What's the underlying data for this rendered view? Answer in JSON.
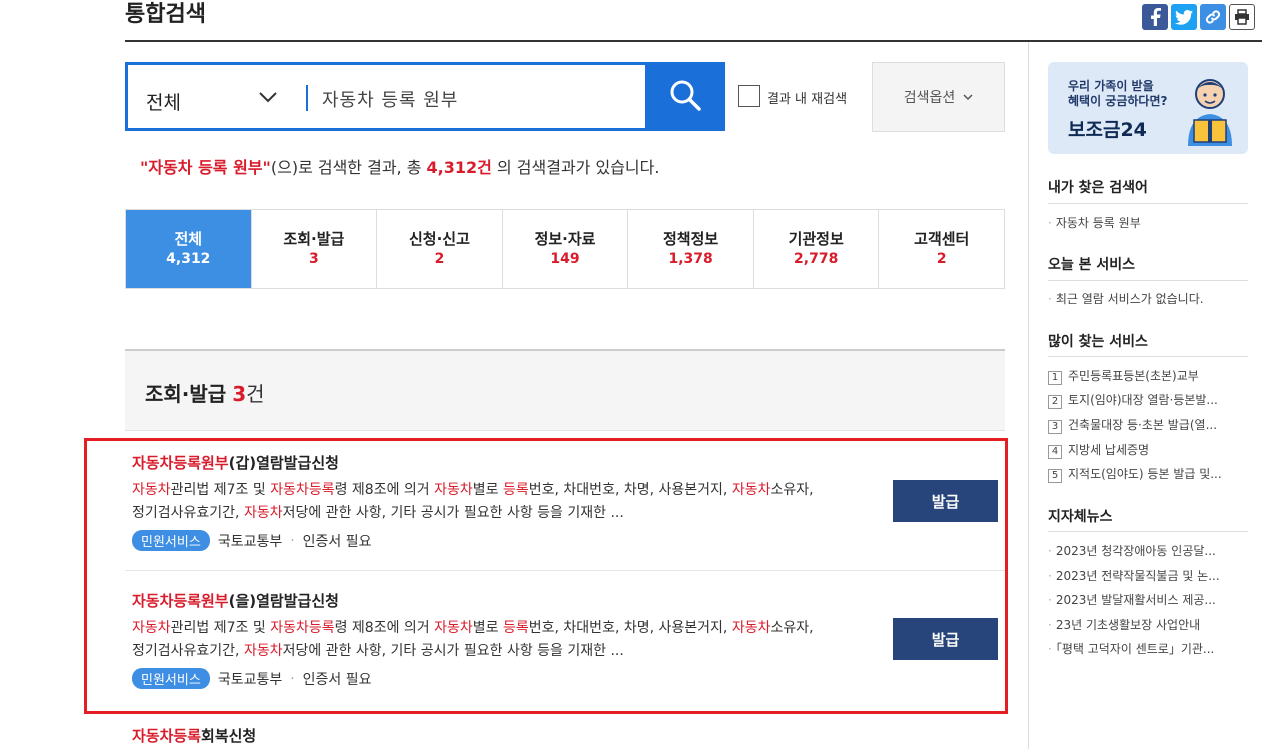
{
  "header": {
    "title": "통합검색"
  },
  "share": {
    "facebook": "f",
    "twitter": "t",
    "link": "link",
    "print": "print"
  },
  "search": {
    "category": "전체",
    "query": "자동차 등록 원부",
    "recheck_label": "결과 내 재검색",
    "options_label": "검색옵션"
  },
  "summary": {
    "keyword": "\"자동차 등록 원부\"",
    "text1": "(으)로 검색한 결과, 총 ",
    "count": "4,312건",
    "text2": " 의 검색결과가 있습니다."
  },
  "tabs": [
    {
      "label": "전체",
      "count": "4,312"
    },
    {
      "label": "조회·발급",
      "count": "3"
    },
    {
      "label": "신청·신고",
      "count": "2"
    },
    {
      "label": "정보·자료",
      "count": "149"
    },
    {
      "label": "정책정보",
      "count": "1,378"
    },
    {
      "label": "기관정보",
      "count": "2,778"
    },
    {
      "label": "고객센터",
      "count": "2"
    }
  ],
  "section": {
    "title": "조회·발급",
    "count": "3",
    "unit": "건"
  },
  "results": [
    {
      "title_hl": "자동차등록원부",
      "title_rest": "(갑)열람발급신청",
      "desc": {
        "p1": "자동차",
        "p2": "관리법 제7조 및 ",
        "p3": "자동차등록",
        "p4": "령 제8조에 의거 ",
        "p5": "자동차",
        "p6": "별로 ",
        "p7": "등록",
        "p8": "번호, 차대번호, 차명, 사용본거지, ",
        "p9": "자동차",
        "p10": "소유자,",
        "p11": "정기검사유효기간, ",
        "p12": "자동차",
        "p13": "저당에 관한 사항, 기타 공시가 필요한 사항 등을 기재한 ..."
      },
      "badge": "민원서비스",
      "org": "국토교통부",
      "cert": "인증서 필요",
      "button": "발급"
    },
    {
      "title_hl": "자동차등록원부",
      "title_rest": "(을)열람발급신청",
      "desc": {
        "p1": "자동차",
        "p2": "관리법 제7조 및 ",
        "p3": "자동차등록",
        "p4": "령 제8조에 의거 ",
        "p5": "자동차",
        "p6": "별로 ",
        "p7": "등록",
        "p8": "번호, 차대번호, 차명, 사용본거지, ",
        "p9": "자동차",
        "p10": "소유자,",
        "p11": "정기검사유효기간, ",
        "p12": "자동차",
        "p13": "저당에 관한 사항, 기타 공시가 필요한 사항 등을 기재한 ..."
      },
      "badge": "민원서비스",
      "org": "국토교통부",
      "cert": "인증서 필요",
      "button": "발급"
    },
    {
      "title_hl": "자동차등록",
      "title_rest": "회복신청"
    }
  ],
  "sidebar": {
    "banner_line1": "우리 가족이 받을",
    "banner_line2": "혜택이 궁금하다면?",
    "banner_title": "보조금24",
    "my_keywords_title": "내가 찾은 검색어",
    "my_keywords": [
      "자동차 등록 원부"
    ],
    "today_title": "오늘 본 서비스",
    "today_items": [
      "최근 열람 서비스가 없습니다."
    ],
    "popular_title": "많이 찾는 서비스",
    "popular": [
      {
        "rank": "1",
        "label": "주민등록표등본(초본)교부"
      },
      {
        "rank": "2",
        "label": "토지(임야)대장 열람·등본발..."
      },
      {
        "rank": "3",
        "label": "건축물대장 등·초본 발급(열..."
      },
      {
        "rank": "4",
        "label": "지방세 납세증명"
      },
      {
        "rank": "5",
        "label": "지적도(임야도) 등본 발급 및..."
      }
    ],
    "news_title": "지자체뉴스",
    "news": [
      "2023년 청각장애아동 인공달...",
      "2023년 전략작물직불금 및 논...",
      "2023년 발달재활서비스 제공...",
      "23년 기초생활보장 사업안내",
      "「평택 고덕자이 센트로」기관..."
    ]
  },
  "colors": {
    "accent": "#1a6fd8",
    "highlight": "#d91c2b",
    "button": "#27457a",
    "badge": "#3e8ee3"
  }
}
